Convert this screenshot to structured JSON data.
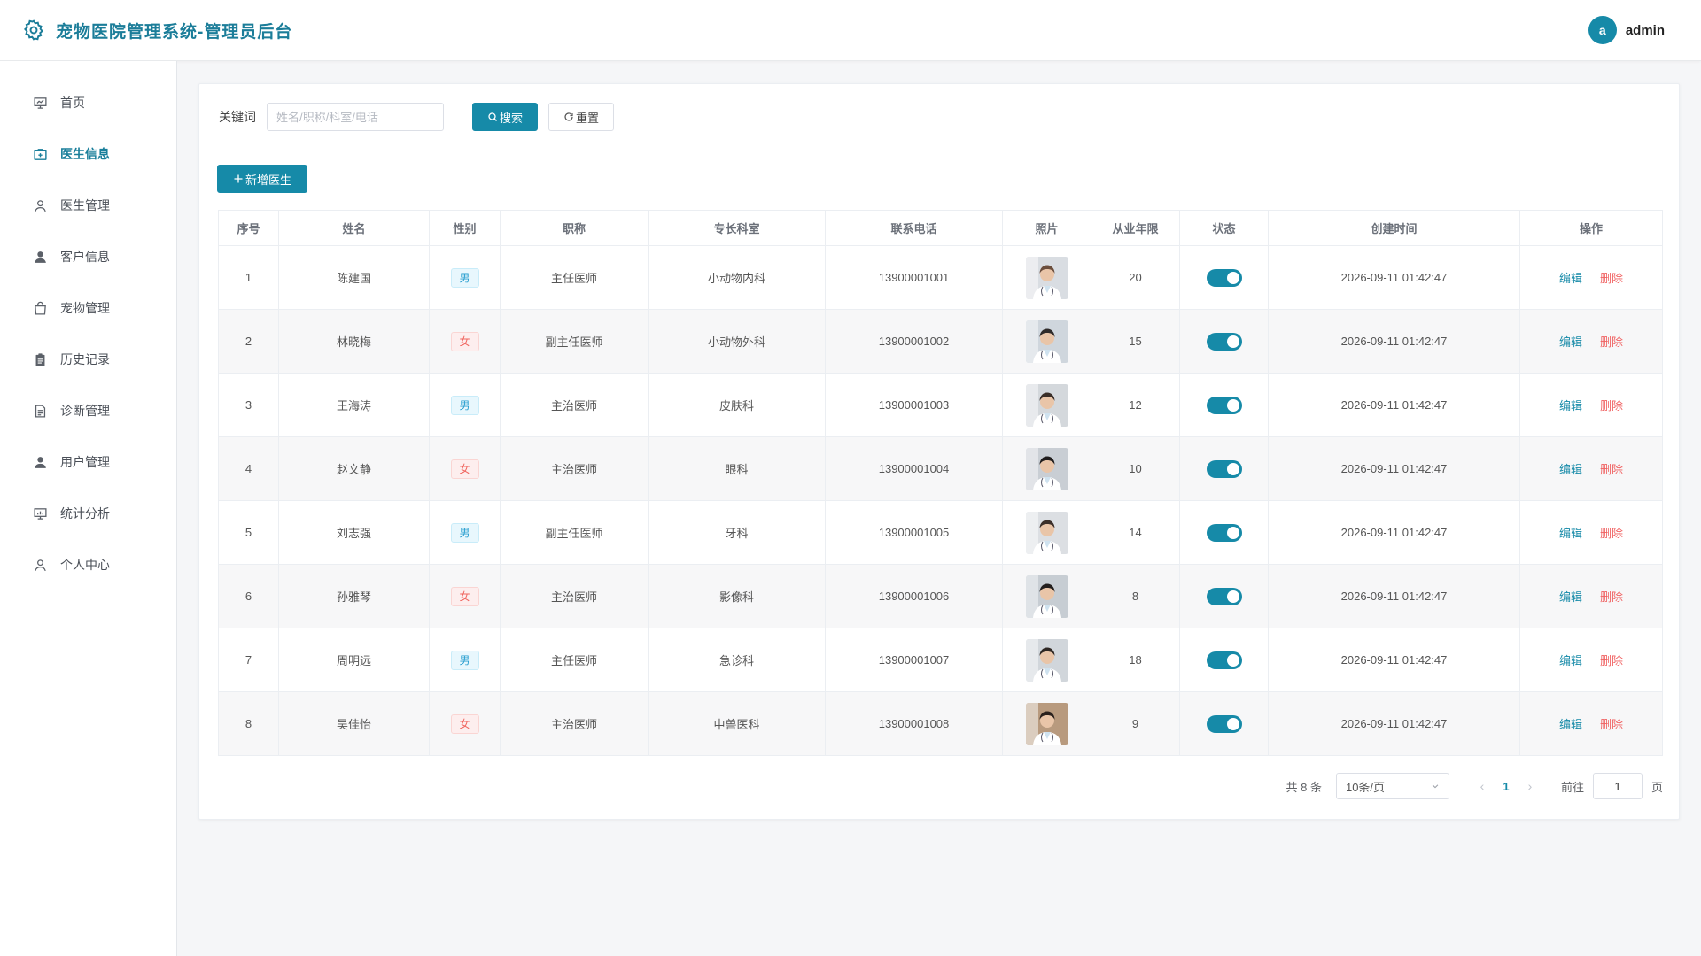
{
  "header": {
    "title": "宠物医院管理系统-管理员后台",
    "avatar_letter": "a",
    "username": "admin",
    "brand_color": "#168aa8"
  },
  "sidebar": {
    "items": [
      {
        "label": "首页",
        "icon": "presentation-board-icon",
        "active": false
      },
      {
        "label": "医生信息",
        "icon": "medical-kit-icon",
        "active": true
      },
      {
        "label": "医生管理",
        "icon": "user-outline-icon",
        "active": false
      },
      {
        "label": "客户信息",
        "icon": "user-filled-icon",
        "active": false
      },
      {
        "label": "宠物管理",
        "icon": "shopping-bag-icon",
        "active": false
      },
      {
        "label": "历史记录",
        "icon": "clipboard-icon",
        "active": false
      },
      {
        "label": "诊断管理",
        "icon": "document-icon",
        "active": false
      },
      {
        "label": "用户管理",
        "icon": "user-filled-icon",
        "active": false
      },
      {
        "label": "统计分析",
        "icon": "chart-board-icon",
        "active": false
      },
      {
        "label": "个人中心",
        "icon": "user-outline-icon",
        "active": false
      }
    ]
  },
  "search": {
    "label": "关键词",
    "placeholder": "姓名/职称/科室/电话",
    "value": "",
    "search_button": "搜索",
    "reset_button": "重置"
  },
  "add_button": "新增医生",
  "table": {
    "headers": [
      "序号",
      "姓名",
      "性别",
      "职称",
      "专长科室",
      "联系电话",
      "照片",
      "从业年限",
      "状态",
      "创建时间",
      "操作"
    ],
    "edit_label": "编辑",
    "delete_label": "删除",
    "rows": [
      {
        "no": "1",
        "name": "陈建国",
        "gender": "男",
        "title": "主任医师",
        "dept": "小动物内科",
        "phone": "13900001001",
        "years": "20",
        "status_on": true,
        "created": "2026-09-11 01:42:47"
      },
      {
        "no": "2",
        "name": "林晓梅",
        "gender": "女",
        "title": "副主任医师",
        "dept": "小动物外科",
        "phone": "13900001002",
        "years": "15",
        "status_on": true,
        "created": "2026-09-11 01:42:47"
      },
      {
        "no": "3",
        "name": "王海涛",
        "gender": "男",
        "title": "主治医师",
        "dept": "皮肤科",
        "phone": "13900001003",
        "years": "12",
        "status_on": true,
        "created": "2026-09-11 01:42:47"
      },
      {
        "no": "4",
        "name": "赵文静",
        "gender": "女",
        "title": "主治医师",
        "dept": "眼科",
        "phone": "13900001004",
        "years": "10",
        "status_on": true,
        "created": "2026-09-11 01:42:47"
      },
      {
        "no": "5",
        "name": "刘志强",
        "gender": "男",
        "title": "副主任医师",
        "dept": "牙科",
        "phone": "13900001005",
        "years": "14",
        "status_on": true,
        "created": "2026-09-11 01:42:47"
      },
      {
        "no": "6",
        "name": "孙雅琴",
        "gender": "女",
        "title": "主治医师",
        "dept": "影像科",
        "phone": "13900001006",
        "years": "8",
        "status_on": true,
        "created": "2026-09-11 01:42:47"
      },
      {
        "no": "7",
        "name": "周明远",
        "gender": "男",
        "title": "主任医师",
        "dept": "急诊科",
        "phone": "13900001007",
        "years": "18",
        "status_on": true,
        "created": "2026-09-11 01:42:47"
      },
      {
        "no": "8",
        "name": "吴佳怡",
        "gender": "女",
        "title": "主治医师",
        "dept": "中兽医科",
        "phone": "13900001008",
        "years": "9",
        "status_on": true,
        "created": "2026-09-11 01:42:47"
      }
    ]
  },
  "pagination": {
    "total_text": "共 8 条",
    "page_size": "10条/页",
    "current_page": "1",
    "goto_label": "前往",
    "goto_value": "1",
    "page_unit": "页"
  }
}
